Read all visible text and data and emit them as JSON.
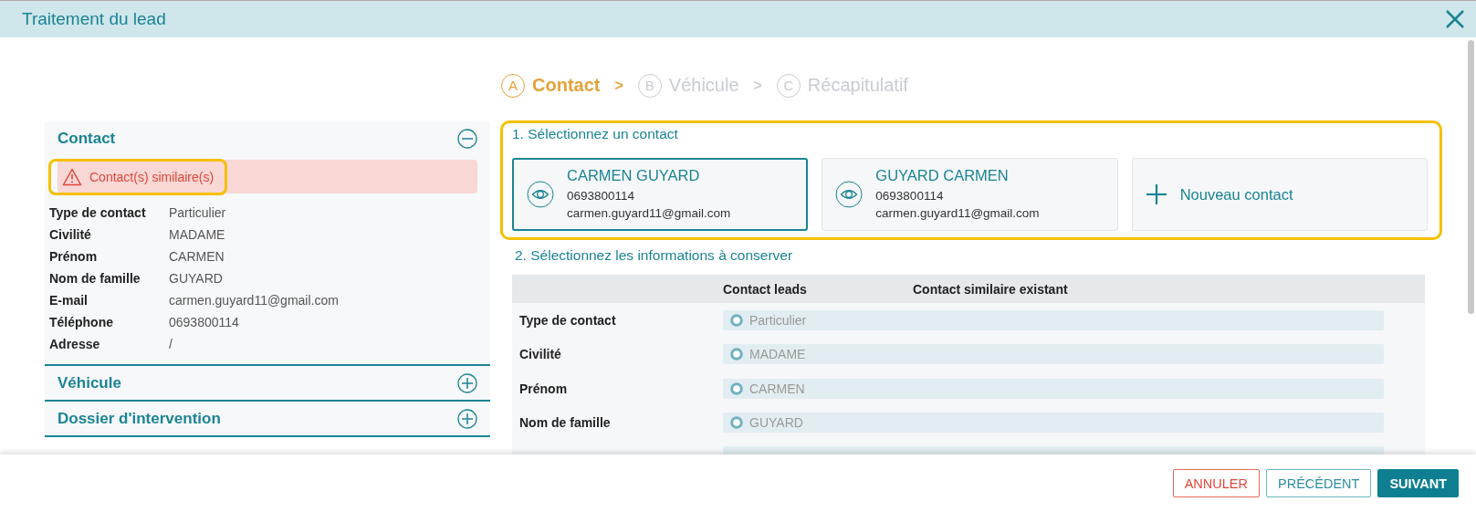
{
  "window": {
    "title": "Traitement du lead"
  },
  "steps": [
    {
      "letter": "A",
      "label": "Contact",
      "selected": true
    },
    {
      "letter": "B",
      "label": "Véhicule",
      "selected": false
    },
    {
      "letter": "C",
      "label": "Récapitulatif",
      "selected": false
    }
  ],
  "step_separator": ">",
  "sidebar": {
    "sections": [
      {
        "title": "Contact",
        "expanded": true,
        "alert": {
          "text": "Contact(s) similaire(s)",
          "highlighted": true
        },
        "fields": [
          {
            "label": "Type de contact",
            "value": "Particulier"
          },
          {
            "label": "Civilité",
            "value": "MADAME"
          },
          {
            "label": "Prénom",
            "value": "CARMEN"
          },
          {
            "label": "Nom de famille",
            "value": "GUYARD"
          },
          {
            "label": "E-mail",
            "value": "carmen.guyard11@gmail.com"
          },
          {
            "label": "Téléphone",
            "value": "0693800114"
          },
          {
            "label": "Adresse",
            "value": "/"
          }
        ]
      },
      {
        "title": "Véhicule",
        "expanded": false
      },
      {
        "title": "Dossier d'intervention",
        "expanded": false
      }
    ]
  },
  "contact_selection": {
    "title": "1. Sélectionnez un contact",
    "highlighted": true,
    "cards": [
      {
        "kind": "contact",
        "name": "CARMEN GUYARD",
        "phone": "0693800114",
        "email": "carmen.guyard11@gmail.com",
        "selected": true
      },
      {
        "kind": "contact",
        "name": "GUYARD CARMEN",
        "phone": "0693800114",
        "email": "carmen.guyard11@gmail.com",
        "selected": false
      },
      {
        "kind": "new",
        "name": "Nouveau contact",
        "selected": false
      }
    ]
  },
  "info_selection": {
    "title": "2. Sélectionnez les informations à conserver",
    "columns": [
      "Contact leads",
      "Contact similaire existant"
    ],
    "rows": [
      {
        "label": "Type de contact",
        "value": "Particulier",
        "disabled": true
      },
      {
        "label": "Civilité",
        "value": "MADAME",
        "disabled": true
      },
      {
        "label": "Prénom",
        "value": "CARMEN",
        "disabled": true
      },
      {
        "label": "Nom de famille",
        "value": "GUYARD",
        "disabled": true
      }
    ]
  },
  "buttons": [
    {
      "kind": "danger",
      "label": "ANNULER"
    },
    {
      "kind": "outline",
      "label": "PRÉCÉDENT"
    },
    {
      "kind": "primary",
      "label": "SUIVANT"
    }
  ]
}
